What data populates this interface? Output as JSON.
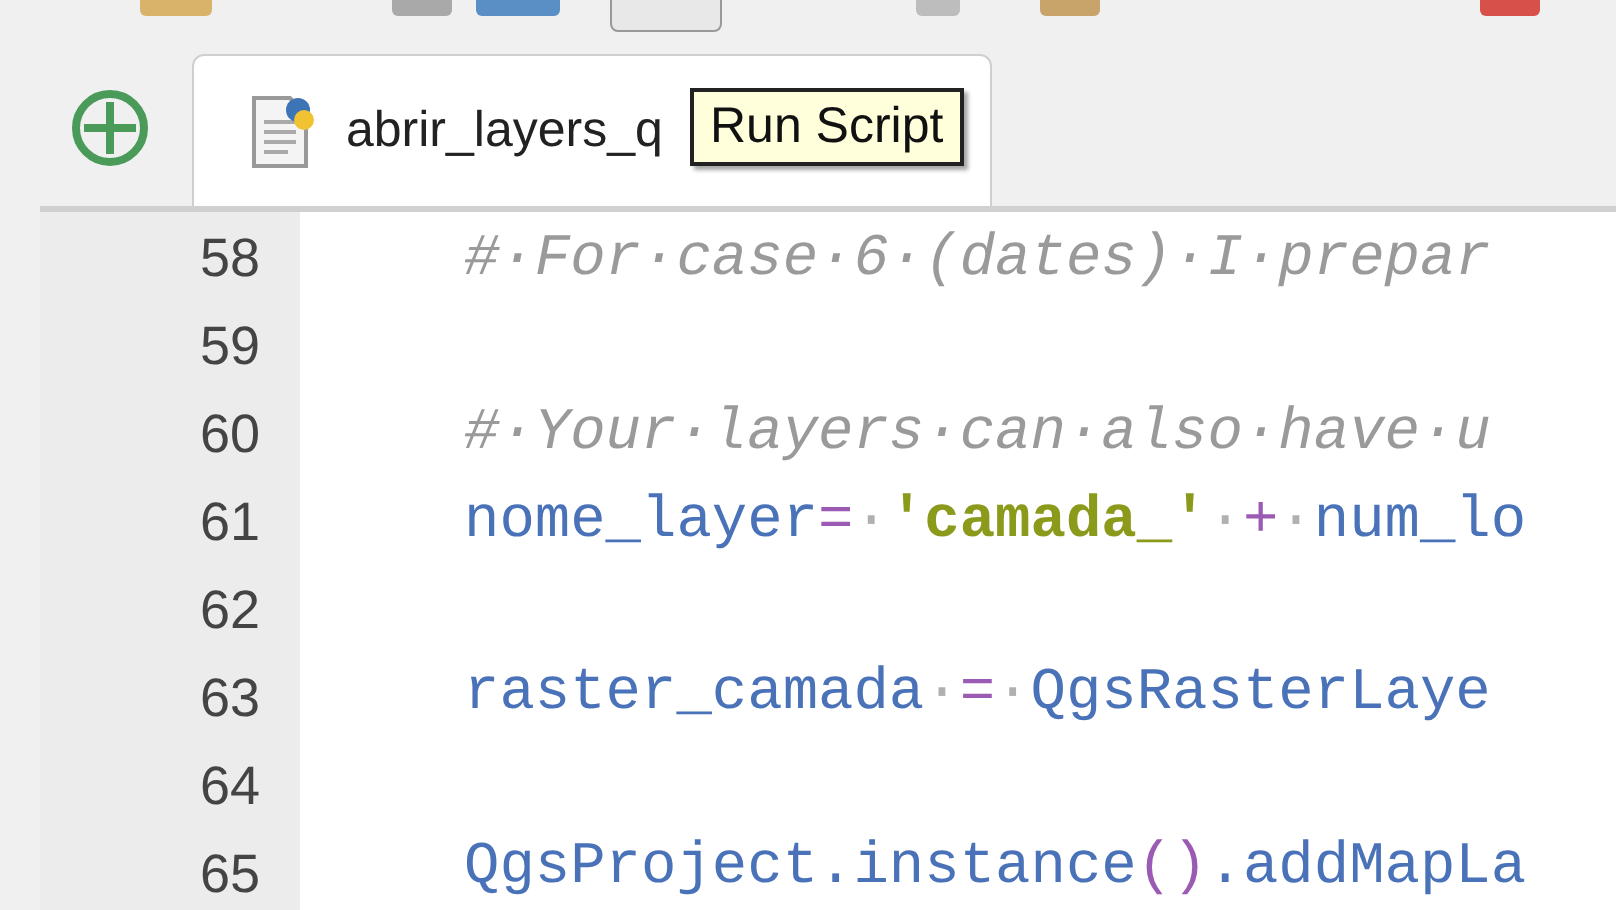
{
  "tab": {
    "label": "abrir_layers_q",
    "selected": true
  },
  "tooltip": {
    "text": "Run Script"
  },
  "editor": {
    "lines": [
      {
        "number": "58",
        "tokens": [
          {
            "kind": "comment",
            "text": "#·For·case·6·(dates)·I·prepar"
          }
        ]
      },
      {
        "number": "59"
      },
      {
        "number": "60",
        "tokens": [
          {
            "kind": "comment",
            "text": "#·Your·layers·can·also·have·u"
          }
        ]
      },
      {
        "number": "61",
        "tokens": [
          {
            "kind": "name",
            "text": "nome_layer"
          },
          {
            "kind": "operator",
            "text": "="
          },
          {
            "kind": "space",
            "text": "·"
          },
          {
            "kind": "string",
            "text": "'camada_'"
          },
          {
            "kind": "space",
            "text": "·"
          },
          {
            "kind": "operator",
            "text": "+"
          },
          {
            "kind": "space",
            "text": "·"
          },
          {
            "kind": "name",
            "text": "num_lo"
          }
        ]
      },
      {
        "number": "62"
      },
      {
        "number": "63",
        "tokens": [
          {
            "kind": "name",
            "text": "raster_camada"
          },
          {
            "kind": "space",
            "text": "·"
          },
          {
            "kind": "operator",
            "text": "="
          },
          {
            "kind": "space",
            "text": "·"
          },
          {
            "kind": "name",
            "text": "QgsRasterLaye"
          }
        ]
      },
      {
        "number": "64"
      },
      {
        "number": "65",
        "tokens": [
          {
            "kind": "name",
            "text": "QgsProject.instance"
          },
          {
            "kind": "operator",
            "text": "()"
          },
          {
            "kind": "name",
            "text": ".addMapLa"
          }
        ]
      }
    ]
  }
}
